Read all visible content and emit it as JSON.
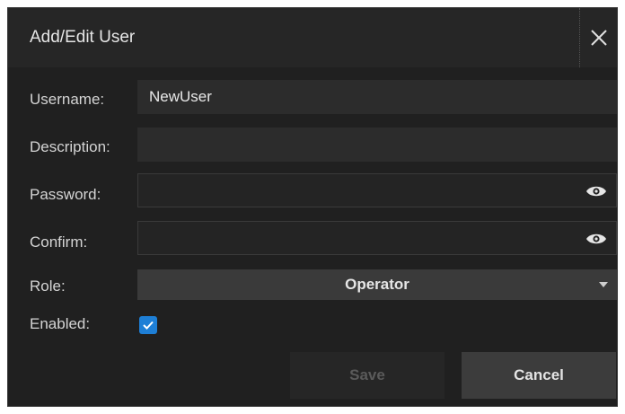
{
  "dialog": {
    "title": "Add/Edit User",
    "close_icon": "close-icon"
  },
  "form": {
    "username": {
      "label": "Username:",
      "value": "NewUser"
    },
    "description": {
      "label": "Description:",
      "value": ""
    },
    "password": {
      "label": "Password:",
      "value": "",
      "icon": "eye-icon"
    },
    "confirm": {
      "label": "Confirm:",
      "value": "",
      "icon": "eye-icon"
    },
    "role": {
      "label": "Role:",
      "value": "Operator",
      "icon": "chevron-down-icon"
    },
    "enabled": {
      "label": "Enabled:",
      "checked": true,
      "icon": "checkmark-icon"
    }
  },
  "buttons": {
    "save": "Save",
    "cancel": "Cancel"
  },
  "colors": {
    "background": "#202020",
    "titlebar": "#262626",
    "field": "#2c2c2c",
    "accent": "#1e7fd6",
    "disabled_text": "#5a5a5a"
  }
}
